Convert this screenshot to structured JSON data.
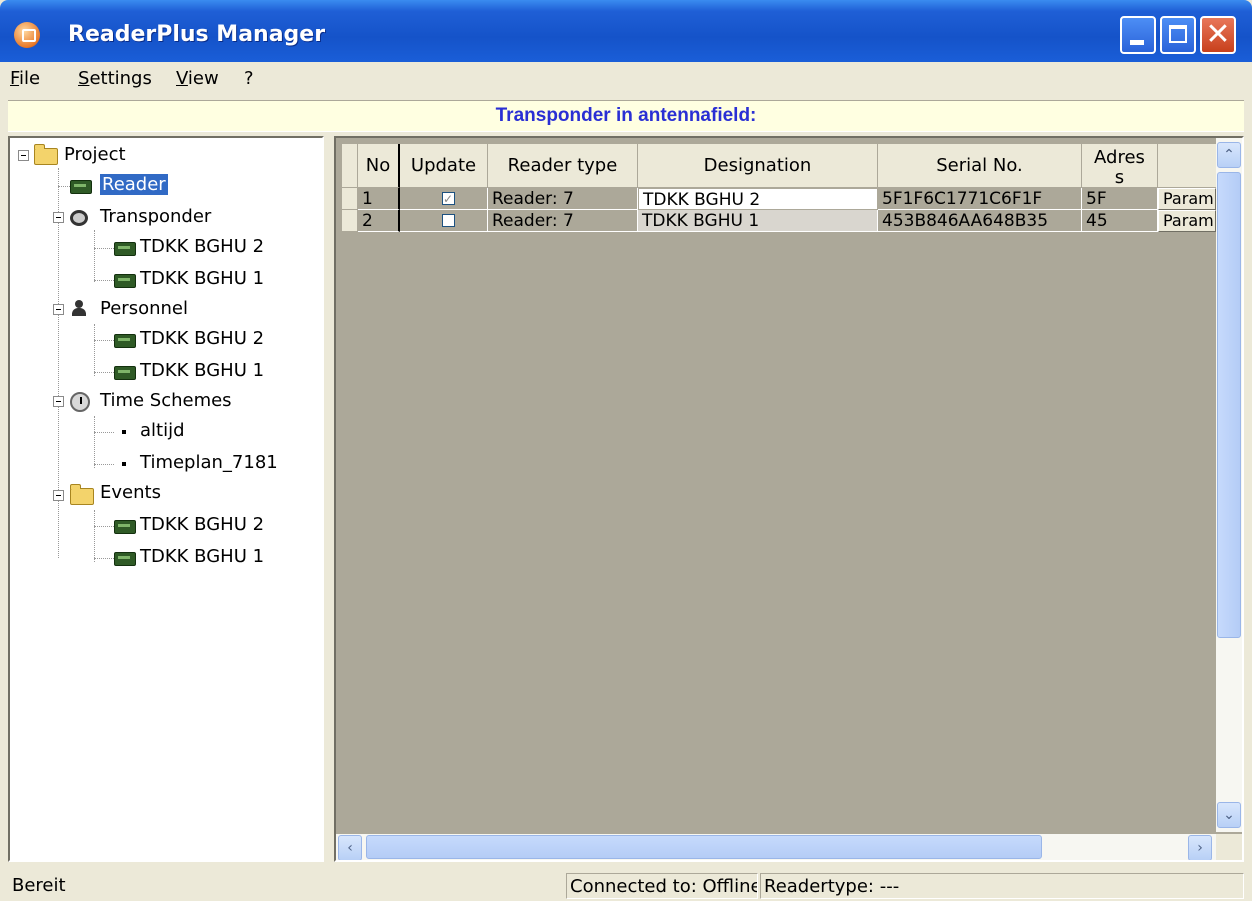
{
  "window": {
    "title": "ReaderPlus Manager"
  },
  "menu": [
    {
      "pre": "",
      "acc": "F",
      "post": "ile"
    },
    {
      "pre": "",
      "acc": "S",
      "post": "ettings"
    },
    {
      "pre": "",
      "acc": "V",
      "post": "iew"
    },
    {
      "pre": "",
      "acc": "",
      "post": "?"
    }
  ],
  "banner": "Transponder in antennafield:",
  "tree": {
    "project": "Project",
    "reader": "Reader",
    "transponder": "Transponder",
    "transponder_children": [
      "TDKK BGHU 2",
      "TDKK BGHU 1"
    ],
    "personnel": "Personnel",
    "personnel_children": [
      "TDKK BGHU 2",
      "TDKK BGHU 1"
    ],
    "time_schemes": "Time Schemes",
    "time_children": [
      "altijd",
      "Timeplan_7181"
    ],
    "events": "Events",
    "events_children": [
      "TDKK BGHU 2",
      "TDKK BGHU 1"
    ]
  },
  "grid": {
    "columns": [
      "No",
      "Update",
      "Reader type",
      "Designation",
      "Serial No.",
      "Adres\ns",
      ""
    ],
    "rows": [
      {
        "no": "1",
        "update": true,
        "reader_type": "Reader: 7",
        "designation": "TDKK BGHU 2",
        "serial": "5F1F6C1771C6F1F",
        "address": "5F",
        "param": "Param"
      },
      {
        "no": "2",
        "update": false,
        "reader_type": "Reader: 7",
        "designation": "TDKK BGHU 1",
        "serial": "453B846AA648B35",
        "address": "45",
        "param": "Param"
      }
    ]
  },
  "status": {
    "left": "Bereit",
    "connected": "Connected to: Offline",
    "readertype": "Readertype: ---"
  }
}
